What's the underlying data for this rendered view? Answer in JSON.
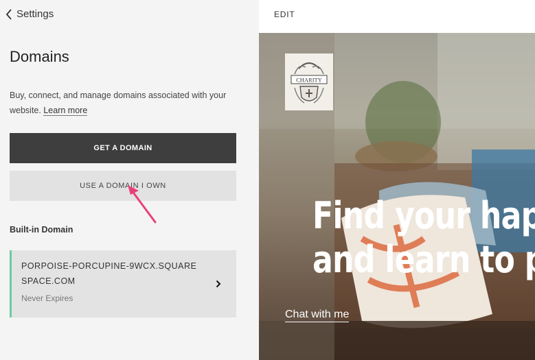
{
  "panel": {
    "back_label": "Settings",
    "title": "Domains",
    "description": "Buy, connect, and manage domains associated with your website.",
    "learn_more": "Learn more",
    "get_domain_label": "GET A DOMAIN",
    "use_domain_label": "USE A DOMAIN I OWN",
    "builtin_label": "Built-in Domain",
    "domain": {
      "name": "PORPOISE-PORCUPINE-9WCX.SQUARESPACE.COM",
      "expiry": "Never Expires",
      "accent_color": "#6ccba1"
    }
  },
  "preview": {
    "edit_label": "EDIT",
    "logo_text": "CHARITY",
    "headline_line1": "Find your happ",
    "headline_line2": "and learn to pu",
    "cta_label": "Chat with me"
  },
  "icons": {
    "back": "chevron-left-icon",
    "domain_chevron": "chevron-right-icon",
    "annotation": "pink-arrow-pointer"
  }
}
